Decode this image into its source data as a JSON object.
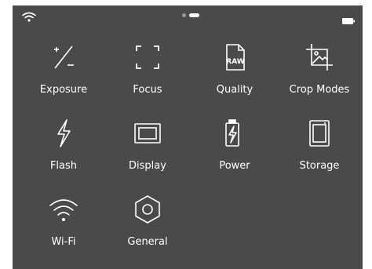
{
  "status_bar": {
    "wifi_icon": "wifi-icon",
    "battery_icon": "battery-icon",
    "page_indicator": {
      "pages": 2,
      "active": 2
    }
  },
  "menu": {
    "items": [
      {
        "label": "Exposure",
        "icon": "exposure-icon"
      },
      {
        "label": "Focus",
        "icon": "focus-icon"
      },
      {
        "label": "Quality",
        "icon": "raw-file-icon",
        "icon_text": "RAW"
      },
      {
        "label": "Crop Modes",
        "icon": "crop-modes-icon"
      },
      {
        "label": "Flash",
        "icon": "flash-icon"
      },
      {
        "label": "Display",
        "icon": "display-icon"
      },
      {
        "label": "Power",
        "icon": "power-battery-icon"
      },
      {
        "label": "Storage",
        "icon": "storage-card-icon"
      },
      {
        "label": "Wi-Fi",
        "icon": "wifi-icon"
      },
      {
        "label": "General",
        "icon": "general-settings-icon"
      }
    ]
  },
  "colors": {
    "background": "#4a4a4a",
    "foreground": "#ffffff",
    "inactive_dot": "#9a9a9a"
  }
}
